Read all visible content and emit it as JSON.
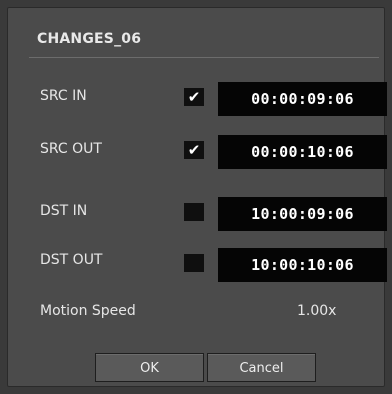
{
  "dialog": {
    "title": "CHANGES_06",
    "rows": [
      {
        "label": "SRC IN",
        "checked": true,
        "timecode": "00:00:09:06"
      },
      {
        "label": "SRC OUT",
        "checked": true,
        "timecode": "00:00:10:06"
      },
      {
        "label": "DST IN",
        "checked": false,
        "timecode": "10:00:09:06"
      },
      {
        "label": "DST OUT",
        "checked": false,
        "timecode": "10:00:10:06"
      }
    ],
    "motion_speed": {
      "label": "Motion Speed",
      "value": "1.00x"
    },
    "buttons": {
      "ok": "OK",
      "cancel": "Cancel"
    }
  }
}
